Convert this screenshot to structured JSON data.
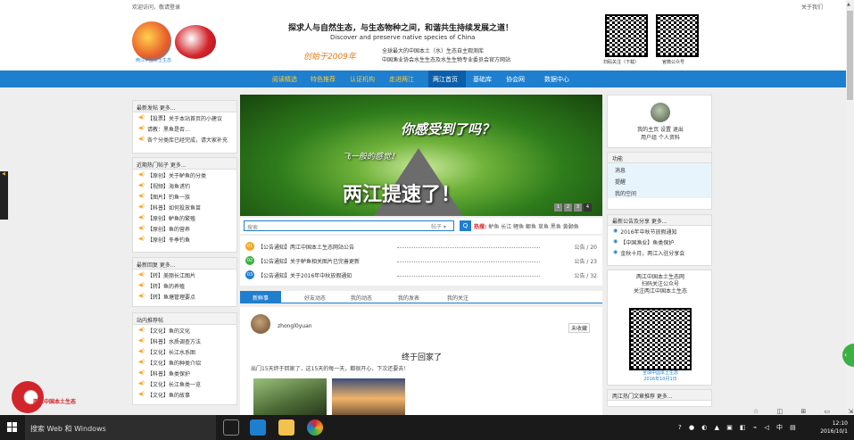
{
  "topbar": {
    "left": "欢迎访问，敬请登录",
    "right": "关于我们"
  },
  "header": {
    "logo_caption": "两江中国本土生态",
    "slogan_cn": "探求人与自然生态，与生态物种之间，和谐共生持续发展之道！",
    "slogan_en": "Discover and preserve native species of China",
    "sign": "创始于2009年",
    "sub1": "全球最大的中国本土（水）生态自主观测库",
    "sub2": "中国渔业协会水生生态及水生生物专业委员会官方网站",
    "qr1_caption": "扫码关注（下载）",
    "qr2_caption": "官微公众号"
  },
  "nav": {
    "items": [
      "阅读精选",
      "特色推荐",
      "认证机构",
      "走进两江",
      "两江首页",
      "基础库",
      "协会网",
      "数据中心"
    ]
  },
  "left": {
    "box1": {
      "title": "最新发帖 更多...",
      "rows": [
        "【投票】关于本站首页的小建议",
        "请教：黑鱼是否…",
        "各个分类库已经完成，请大家补充"
      ]
    },
    "box2": {
      "title": "近期热门帖子 更多...",
      "rows": [
        "【原创】关于鲈鱼的分类",
        "【视频】海鱼诱钓",
        "【图片】钓鱼一族",
        "【科普】如何投放鱼苗",
        "【原创】鲈鱼的繁殖",
        "【原创】鱼的营养",
        "【原创】冬季钓鱼"
      ]
    },
    "box3": {
      "title": "最新回复 更多...",
      "rows": [
        "【转】美丽长江图片",
        "【转】鱼的养殖",
        "【转】鱼塘管理要点"
      ]
    },
    "box4": {
      "title": "站内推荐帖",
      "rows": [
        "【文化】鱼的文化",
        "【科普】水质调查方法",
        "【文化】长江水系图",
        "【文化】鱼的种类介绍",
        "【科普】鱼类保护",
        "【文化】长江鱼类一览",
        "【文化】鱼的故事"
      ]
    }
  },
  "banner": {
    "line1": "你感受到了吗？",
    "line2": "飞一般的感觉！",
    "line3": "两江提速了！",
    "pages": [
      "1",
      "2",
      "3",
      "4"
    ]
  },
  "search": {
    "placeholder": "搜索",
    "select": "帖子 ▾",
    "button": "Q",
    "hot_label": "热搜:",
    "hot_words": "鲈鱼 长江 鲤鱼 鲫鱼 草鱼 黑鱼 黄颡鱼"
  },
  "list": [
    {
      "num": "01",
      "color": "#f5a623",
      "title": "【公告通知】两江中国本土生态网站公告",
      "meta": "公告 / 20"
    },
    {
      "num": "02",
      "color": "#3cb043",
      "title": "【公告通知】关于鲈鱼相关图片已完善更新",
      "meta": "公告 / 23"
    },
    {
      "num": "03",
      "color": "#1e7fcf",
      "title": "【公告通知】关于2016年中秋放假通知",
      "meta": "公告 / 32"
    }
  ],
  "tabs": [
    "新鲜事",
    "好友动态",
    "我的动态",
    "我的发表",
    "我的关注"
  ],
  "post": {
    "author": "zhongl0yuan",
    "badge": "未收藏",
    "title": "终于回家了",
    "line": "出门15天终于回家了，这15天的每一天，都很开心，下次还要去！"
  },
  "right": {
    "user_links": "我的主页  设置  退出",
    "user_links2": "用户组  个人资料",
    "menu_title": "功能",
    "menu": [
      "消息",
      "提醒",
      "我的空间"
    ],
    "forum_title": "最新公告及分享 更多...",
    "forum": [
      "2016年中秋节放假通知",
      "【中国渔业】鱼类保护",
      "金秋十月，两江入驻分享会"
    ],
    "qr_caption1": "两江中国本土生态网",
    "qr_caption2": "扫码关注公众号",
    "qr_caption3": "关注两江中国本土生态",
    "qr_foot": "全球中国本土生态",
    "qr_foot2": "2016年10月1日",
    "hot_title": "两江热门文章推荐 更多..."
  },
  "taskbar": {
    "search_text": "搜索 Web 和 Windows",
    "time": "12:10",
    "date": "2016/10/1"
  },
  "colors": {
    "nav_blue": "#1e7fcf",
    "accent_orange": "#f5a623",
    "brand_red": "#d2242b"
  }
}
